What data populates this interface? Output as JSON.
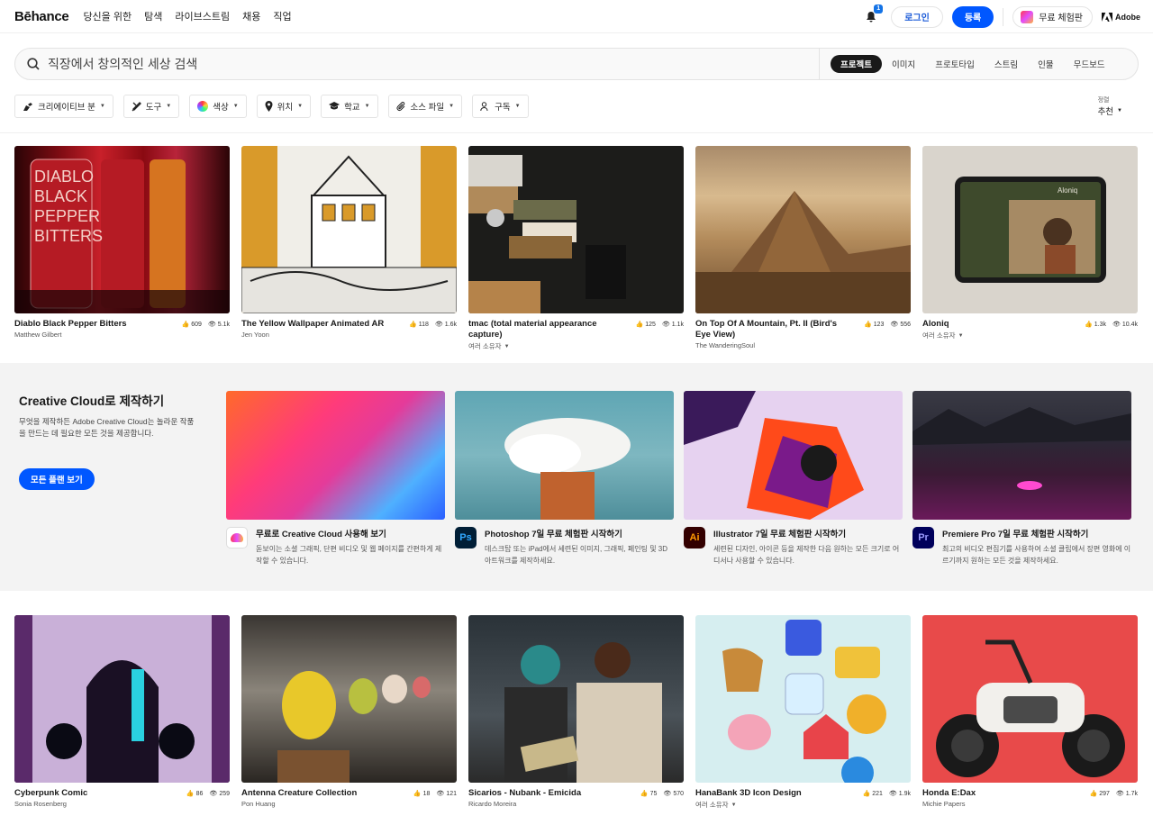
{
  "header": {
    "logo": "Bēhance",
    "nav": [
      "당신을 위한",
      "탐색",
      "라이브스트림",
      "채용",
      "직업"
    ],
    "notification_count": "1",
    "login": "로그인",
    "signup": "등록",
    "trial": "무료 체험판",
    "adobe": "Adobe"
  },
  "search": {
    "placeholder": "직장에서 창의적인 세상 검색",
    "tabs": [
      "프로젝트",
      "이미지",
      "프로토타입",
      "스트림",
      "인물",
      "무드보드"
    ],
    "active_tab": "프로젝트"
  },
  "filters": [
    "크리에이티브 분",
    "도구",
    "색상",
    "위치",
    "학교",
    "소스 파일",
    "구독"
  ],
  "sort": {
    "label": "정렬",
    "value": "추천"
  },
  "projects_top": [
    {
      "title": "Diablo Black Pepper Bitters",
      "owner": "Matthew Gilbert",
      "likes": "609",
      "views": "5.1k",
      "dropdown": false
    },
    {
      "title": "The Yellow Wallpaper Animated AR",
      "owner": "Jen Yoon",
      "likes": "118",
      "views": "1.6k",
      "dropdown": false
    },
    {
      "title": "tmac (total material appearance capture)",
      "owner": "여러 소유자",
      "likes": "125",
      "views": "1.1k",
      "dropdown": true
    },
    {
      "title": "On Top Of A Mountain, Pt. II (Bird's Eye View)",
      "owner": "The WanderingSoul",
      "likes": "123",
      "views": "556",
      "dropdown": false
    },
    {
      "title": "Aloniq",
      "owner": "여러 소유자",
      "likes": "1.3k",
      "views": "10.4k",
      "dropdown": true
    }
  ],
  "cc": {
    "title": "Creative Cloud로 제작하기",
    "description": "무엇을 제작하든 Adobe Creative Cloud는 놀라운 작품을 만드는 데 필요한 모든 것을 제공합니다.",
    "button": "모든 플랜 보기",
    "offers": [
      {
        "icon": "creative-cloud-icon",
        "icon_text": "",
        "title": "무료로 Creative Cloud 사용해 보기",
        "desc": "돋보이는 소셜 그래픽, 단편 비디오 및 웹 페이지를 간편하게 제작할 수 있습니다.",
        "color": "#ffffff"
      },
      {
        "icon": "photoshop-icon",
        "icon_text": "Ps",
        "title": "Photoshop 7일 무료 체험판 시작하기",
        "desc": "데스크탑 또는 iPad에서 세련된 이미지, 그래픽, 페인팅 및 3D 아트워크를 제작하세요.",
        "color": "#001e36"
      },
      {
        "icon": "illustrator-icon",
        "icon_text": "Ai",
        "title": "Illustrator 7일 무료 체험판 시작하기",
        "desc": "세련된 디자인, 아이콘 등을 제작한 다음 원하는 모든 크기로 어디서나 사용할 수 있습니다.",
        "color": "#330000"
      },
      {
        "icon": "premiere-pro-icon",
        "icon_text": "Pr",
        "title": "Premiere Pro 7일 무료 체험판 시작하기",
        "desc": "최고의 비디오 편집기를 사용하여 소셜 클립에서 장편 영화에 이르기까지 원하는 모든 것을 제작하세요.",
        "color": "#00005b"
      }
    ]
  },
  "projects_bottom": [
    {
      "title": "Cyberpunk Comic",
      "owner": "Sonia Rosenberg",
      "likes": "86",
      "views": "259",
      "dropdown": false
    },
    {
      "title": "Antenna Creature Collection",
      "owner": "Pon Huang",
      "likes": "18",
      "views": "121",
      "dropdown": false
    },
    {
      "title": "Sicarios - Nubank - Emicida",
      "owner": "Ricardo Moreira",
      "likes": "75",
      "views": "570",
      "dropdown": false
    },
    {
      "title": "HanaBank 3D Icon Design",
      "owner": "여러 소유자",
      "likes": "221",
      "views": "1.9k",
      "dropdown": true
    },
    {
      "title": "Honda E:Dax",
      "owner": "Michie Papers",
      "likes": "297",
      "views": "1.7k",
      "dropdown": false
    }
  ]
}
